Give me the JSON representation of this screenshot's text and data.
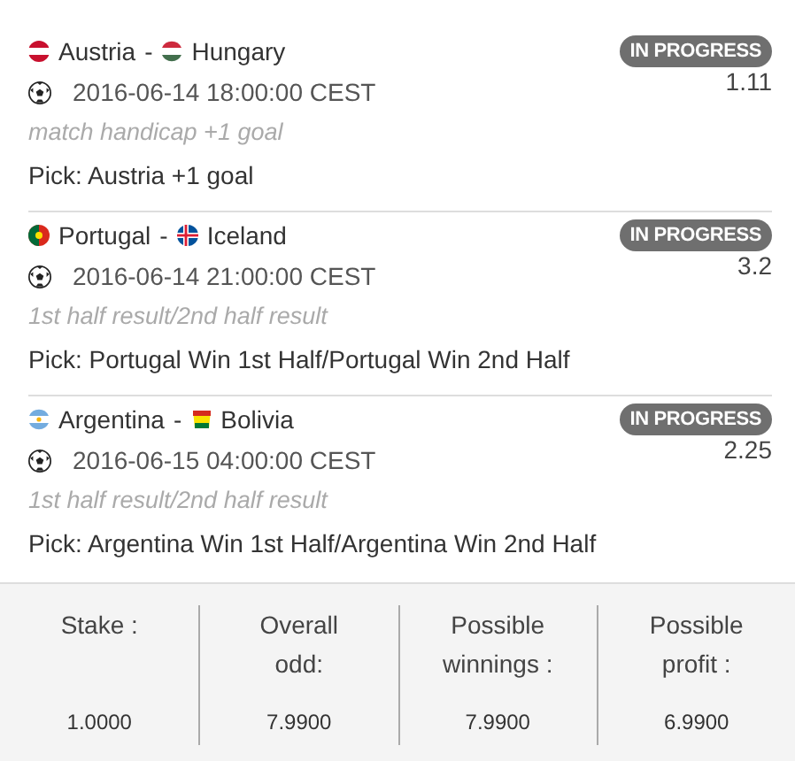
{
  "bets": [
    {
      "home": {
        "name": "Austria",
        "kind": "austria"
      },
      "separator": "-",
      "away": {
        "name": "Hungary",
        "kind": "hungary"
      },
      "status": "IN PROGRESS",
      "datetime": "2016-06-14 18:00:00 CEST",
      "odd": "1.11",
      "market": "match handicap +1 goal",
      "pick": "Pick: Austria +1 goal"
    },
    {
      "home": {
        "name": "Portugal",
        "kind": "portugal"
      },
      "separator": "-",
      "away": {
        "name": "Iceland",
        "kind": "iceland"
      },
      "status": "IN PROGRESS",
      "datetime": "2016-06-14 21:00:00 CEST",
      "odd": "3.2",
      "market": "1st half result/2nd half result",
      "pick": "Pick: Portugal Win 1st Half/Portugal Win 2nd Half"
    },
    {
      "home": {
        "name": "Argentina",
        "kind": "argentina"
      },
      "separator": "-",
      "away": {
        "name": "Bolivia",
        "kind": "bolivia"
      },
      "status": "IN PROGRESS",
      "datetime": "2016-06-15 04:00:00 CEST",
      "odd": "2.25",
      "market": "1st half result/2nd half result",
      "pick": "Pick: Argentina Win 1st Half/Argentina Win 2nd Half"
    }
  ],
  "summary": [
    {
      "label": "Stake :",
      "value": "1.0000"
    },
    {
      "label": "Overall odd:",
      "value": "7.9900"
    },
    {
      "label": "Possible winnings :",
      "value": "7.9900"
    },
    {
      "label": "Possible profit :",
      "value": "6.9900"
    }
  ]
}
